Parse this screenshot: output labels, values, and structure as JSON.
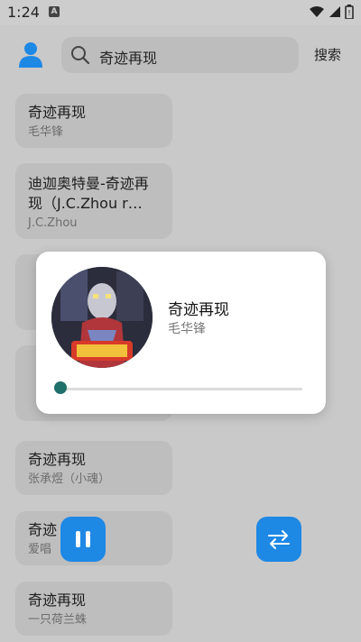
{
  "status_bar": {
    "time": "1:24",
    "notification_glyph": "A",
    "icons": [
      "wifi-icon",
      "signal-icon",
      "battery-icon"
    ]
  },
  "header": {
    "search_value": "奇迹再现",
    "search_button_label": "搜索"
  },
  "songs": [
    {
      "title": "奇迹再现",
      "artist": "毛华锋"
    },
    {
      "title": "迪迦奥特曼-奇迹再现（J.C.Zhou r…",
      "artist": "J.C.Zhou"
    },
    {
      "title": "奇迹再现",
      "artist": "张承煜（小魂）"
    },
    {
      "title": "奇迹",
      "artist": "爱唱"
    },
    {
      "title": "奇迹再现",
      "artist": "一只荷兰蛛"
    }
  ],
  "now_playing": {
    "title": "奇迹再现",
    "artist": "毛华锋",
    "progress": 0.02
  },
  "colors": {
    "accent": "#1e88e5",
    "progress": "#1f6f6a",
    "scrim": "#c9c9c9"
  }
}
